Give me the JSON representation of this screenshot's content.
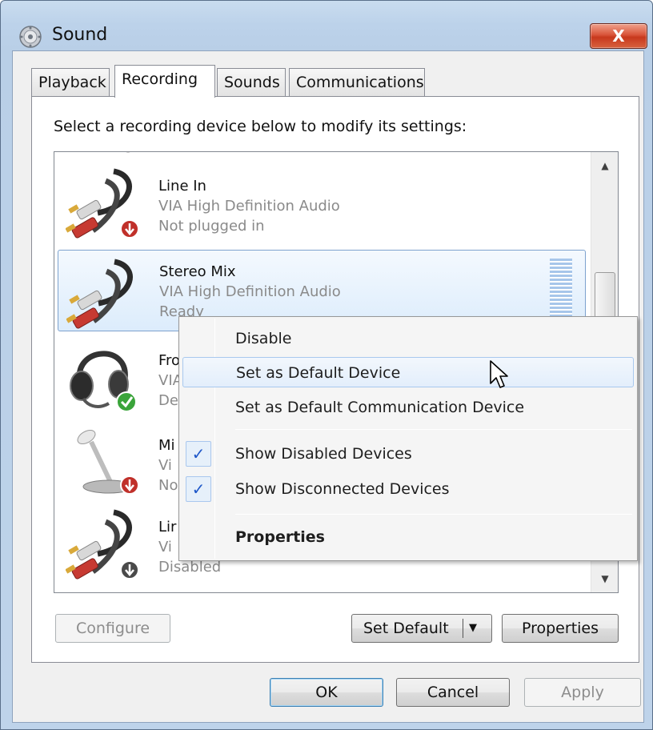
{
  "window": {
    "title": "Sound",
    "close_label": "X"
  },
  "tabs": [
    {
      "label": "Playback"
    },
    {
      "label": "Recording"
    },
    {
      "label": "Sounds"
    },
    {
      "label": "Communications"
    }
  ],
  "instruction": "Select a recording device below to modify its settings:",
  "devices": [
    {
      "name": "Line In",
      "driver": "VIA High Definition Audio",
      "status": "Not plugged in"
    },
    {
      "name": "Stereo Mix",
      "driver": "VIA High Definition Audio",
      "status": "Ready"
    },
    {
      "name": "Fro",
      "driver": "VIA",
      "status": "De"
    },
    {
      "name": "Mi",
      "driver": "Vi",
      "status": "No"
    },
    {
      "name": "Lir",
      "driver": "Vi",
      "status": "Disabled"
    }
  ],
  "context_menu": {
    "items": [
      {
        "label": "Disable"
      },
      {
        "label": "Set as Default Device"
      },
      {
        "label": "Set as Default Communication Device"
      },
      {
        "label": "Show Disabled Devices",
        "checked": true
      },
      {
        "label": "Show Disconnected Devices",
        "checked": true
      },
      {
        "label": "Properties"
      }
    ]
  },
  "buttons": {
    "configure": "Configure",
    "set_default": "Set Default",
    "properties": "Properties",
    "ok": "OK",
    "cancel": "Cancel",
    "apply": "Apply"
  },
  "colors": {
    "selection": "#dcecfc",
    "close_button": "#c7381d",
    "check_mark": "#1f58c9",
    "default_badge": "#3aa43a",
    "unplugged_badge": "#c0302a"
  },
  "icons": {
    "app": "speaker-icon",
    "line_in": "rca-cable-icon",
    "stereo_mix": "rca-cable-icon",
    "front_mic": "headset-icon",
    "microphone": "microphone-icon",
    "line_in_2": "rca-cable-icon"
  }
}
